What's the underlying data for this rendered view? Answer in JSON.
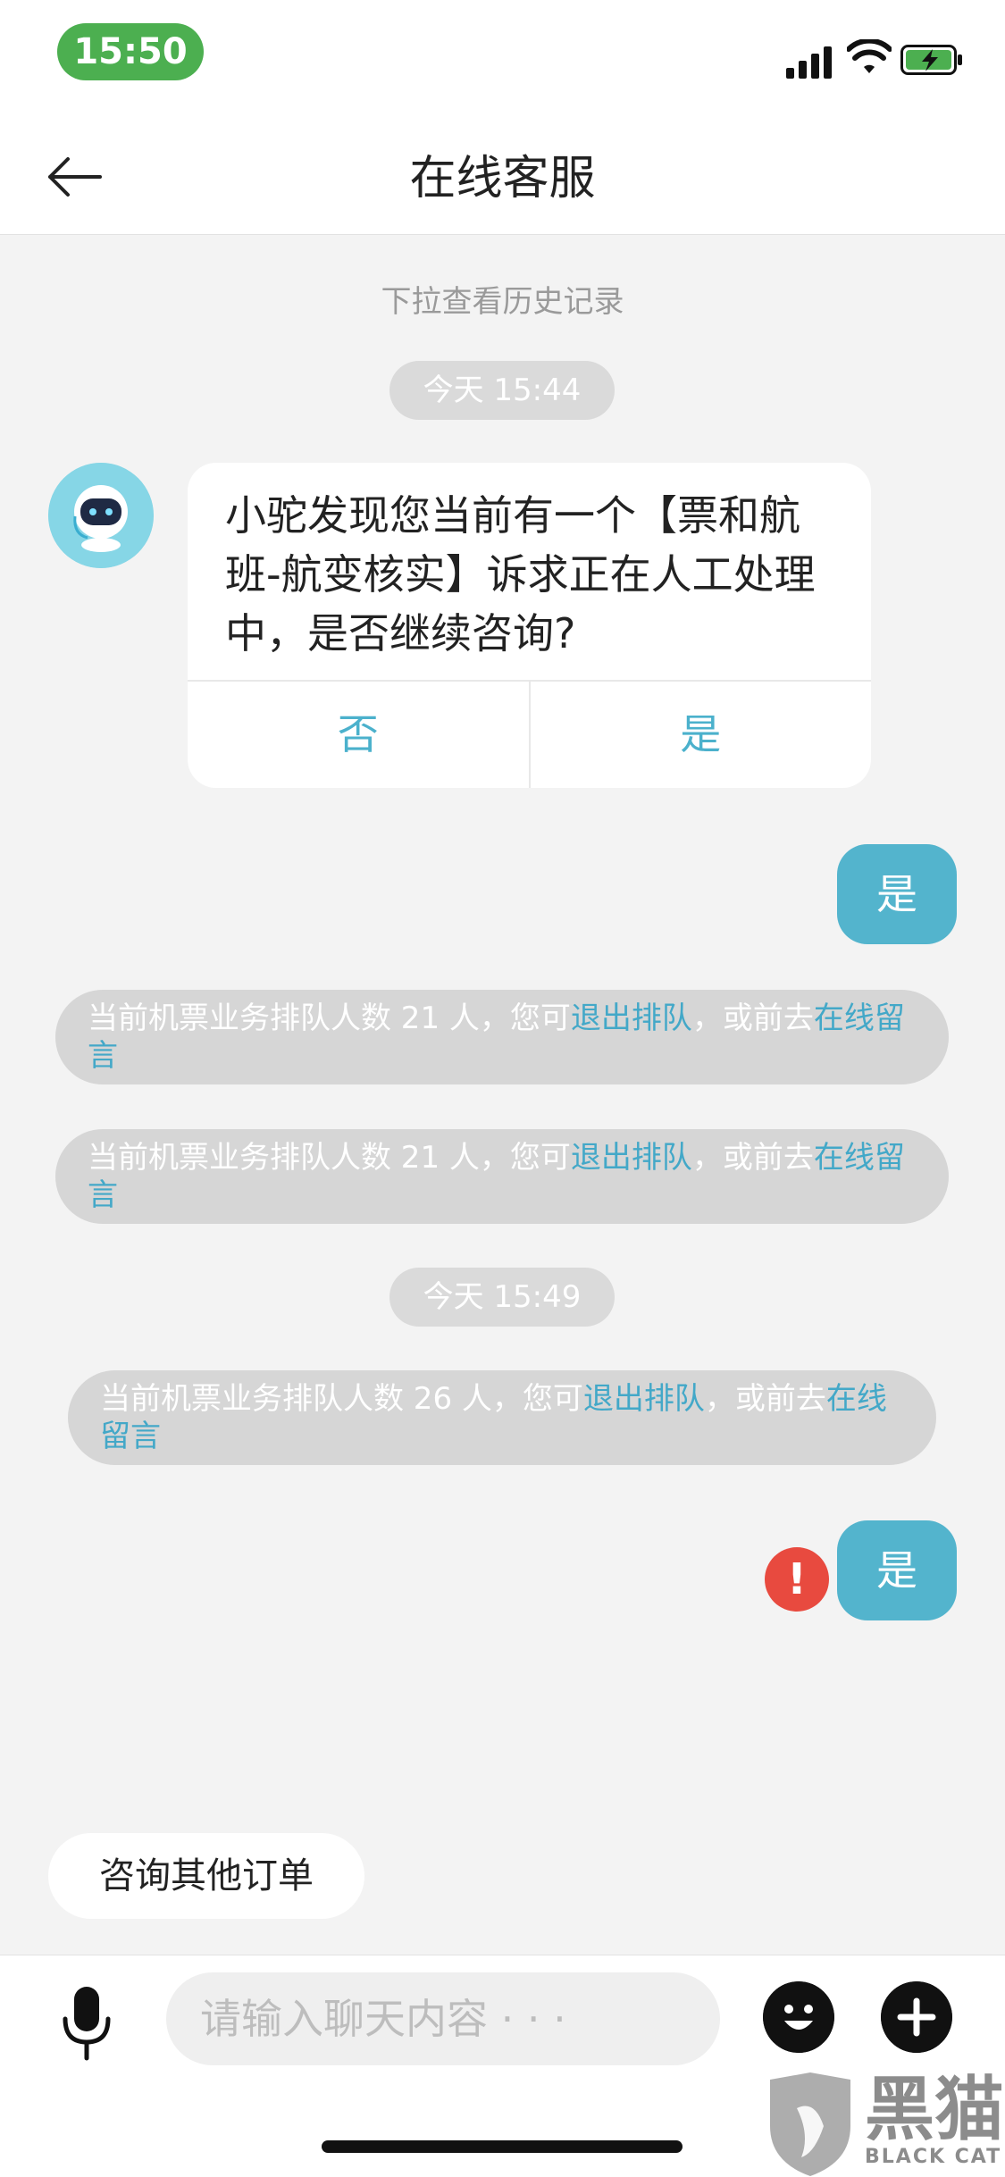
{
  "status_bar": {
    "time": "15:50"
  },
  "nav": {
    "title": "在线客服"
  },
  "chat": {
    "history_hint": "下拉查看历史记录",
    "time_1": "今天 15:44",
    "bot_message": "小驼发现您当前有一个【票和航班-航变核实】诉求正在人工处理中，是否继续咨询?",
    "bot_options": [
      "否",
      "是"
    ],
    "user_reply_1": "是",
    "notices": [
      {
        "prefix": "当前机票业务排队人数 21 人，您可",
        "link1": "退出排队",
        "mid": "，或前去",
        "link2": "在线留言"
      },
      {
        "prefix": "当前机票业务排队人数 21 人，您可",
        "link1": "退出排队",
        "mid": "，或前去",
        "link2": "在线留言"
      },
      {
        "prefix": "当前机票业务排队人数 26 人，您可",
        "link1": "退出排队",
        "mid": "，或前去",
        "link2": "在线留言"
      }
    ],
    "time_2": "今天 15:49",
    "user_reply_2": "是",
    "error_mark": "!"
  },
  "quick_action": "咨询其他订单",
  "input": {
    "placeholder": "请输入聊天内容 · · ·"
  },
  "watermark": {
    "brand": "黑猫",
    "brand_en": "BLACK CAT"
  },
  "colors": {
    "accent": "#53b4cd",
    "link": "#43a8c8",
    "error": "#e84a3f",
    "time_pill": "#4caf50"
  },
  "icons": [
    "back-arrow-icon",
    "signal-icon",
    "wifi-icon",
    "battery-charging-icon",
    "bot-avatar-icon",
    "error-icon",
    "microphone-icon",
    "emoji-icon",
    "plus-icon"
  ]
}
